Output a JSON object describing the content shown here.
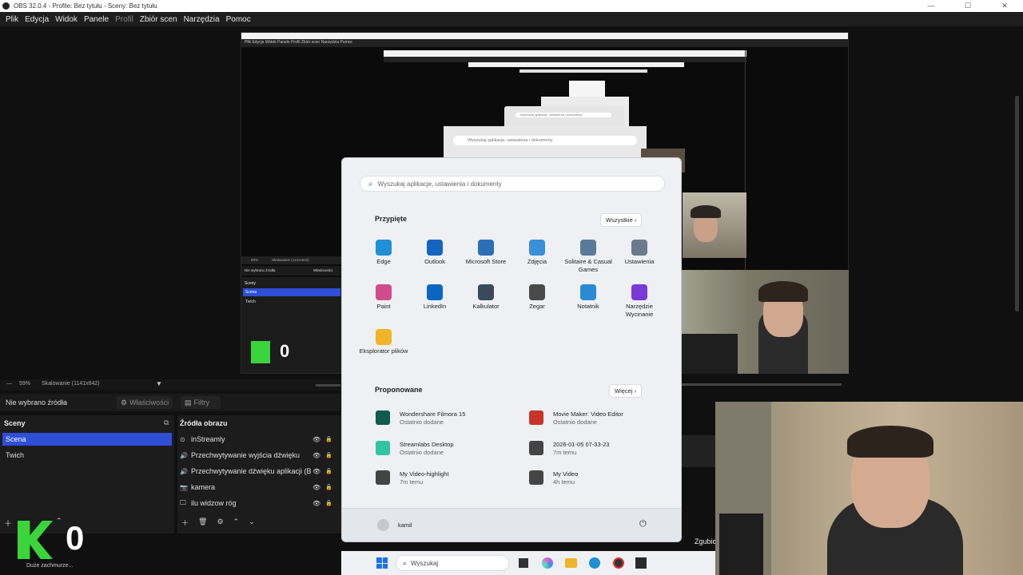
{
  "window": {
    "title": "OBS 32.0.4 - Profile: Bez tytułu - Sceny: Bez tytułu"
  },
  "menu": [
    "Plik",
    "Edycja",
    "Widok",
    "Panele",
    "Profil",
    "Zbiór scen",
    "Narzędzia",
    "Pomoc"
  ],
  "preview_nested": {
    "search_placeholder": "Wyszukaj aplikacje, ustawienia i dokumenty",
    "no_source": "Nie wybrano źródła",
    "props": "Właściwości",
    "scenes_header": "Sceny",
    "scene_items": [
      "Scena",
      "Twich"
    ],
    "zoom": "59%",
    "scaling": "Skalowanie (1141x642)"
  },
  "start_menu": {
    "search_placeholder": "Wyszukaj aplikacje, ustawienia i dokumenty",
    "pinned_title": "Przypięte",
    "all_button": "Wszystkie",
    "pinned": [
      {
        "label": "Edge",
        "color": "#1f8fd6"
      },
      {
        "label": "Outlook",
        "color": "#1565c0"
      },
      {
        "label": "Microsoft Store",
        "color": "#2c6fb5"
      },
      {
        "label": "Zdjęcia",
        "color": "#3a8fd8"
      },
      {
        "label": "Solitaire & Casual Games",
        "color": "#5a7a99"
      },
      {
        "label": "Ustawienia",
        "color": "#6b7b8c"
      },
      {
        "label": "Paint",
        "color": "#d04d8a"
      },
      {
        "label": "LinkedIn",
        "color": "#0a66c2"
      },
      {
        "label": "Kalkulator",
        "color": "#3b4a5b"
      },
      {
        "label": "Zegar",
        "color": "#4a4a4a"
      },
      {
        "label": "Notatnik",
        "color": "#2a8ad4"
      },
      {
        "label": "Narzędzie Wycinanie",
        "color": "#7a3ad8"
      },
      {
        "label": "Eksplorator plików",
        "color": "#f0b429"
      }
    ],
    "recommended_title": "Proponowane",
    "more_button": "Więcej",
    "recommended": [
      {
        "title": "Wondershare Filmora 15",
        "sub": "Ostatnio dodane",
        "color": "#0f5c4a"
      },
      {
        "title": "Movie Maker: Video Editor",
        "sub": "Ostatnio dodane",
        "color": "#c8332b"
      },
      {
        "title": "Streamlabs Desktop",
        "sub": "Ostatnio dodane",
        "color": "#31c3a2"
      },
      {
        "title": "2026-01-05 07-33-23",
        "sub": "7m temu",
        "color": "#444444"
      },
      {
        "title": "My Video-highlight",
        "sub": "7m temu",
        "color": "#444444"
      },
      {
        "title": "My Video",
        "sub": "4h temu",
        "color": "#444444"
      }
    ],
    "user": "kamil"
  },
  "obs": {
    "zoom": "59%",
    "scaling": "Skalowanie (1141x642)",
    "no_source": "Nie wybrano źródła",
    "properties": "Właściwości",
    "filters": "Filtry",
    "scenes_header": "Sceny",
    "scenes": [
      "Scena",
      "Twich"
    ],
    "sources_header": "Źródła obrazu",
    "sources": [
      "inStreamly",
      "Przechwytywanie wyjścia dźwięku",
      "Przechwytywanie dźwięku aplikacji (B",
      "kamera",
      "ilu widzow róg"
    ],
    "overlay_counter": "0",
    "overlay_caption": "Duże zachmurze...",
    "right_cut_text": "Zgubic"
  },
  "taskbar": {
    "search_placeholder": "Wyszukaj"
  },
  "colors": {
    "selection": "#2e4fd6",
    "accent_green": "#3bd43b"
  }
}
